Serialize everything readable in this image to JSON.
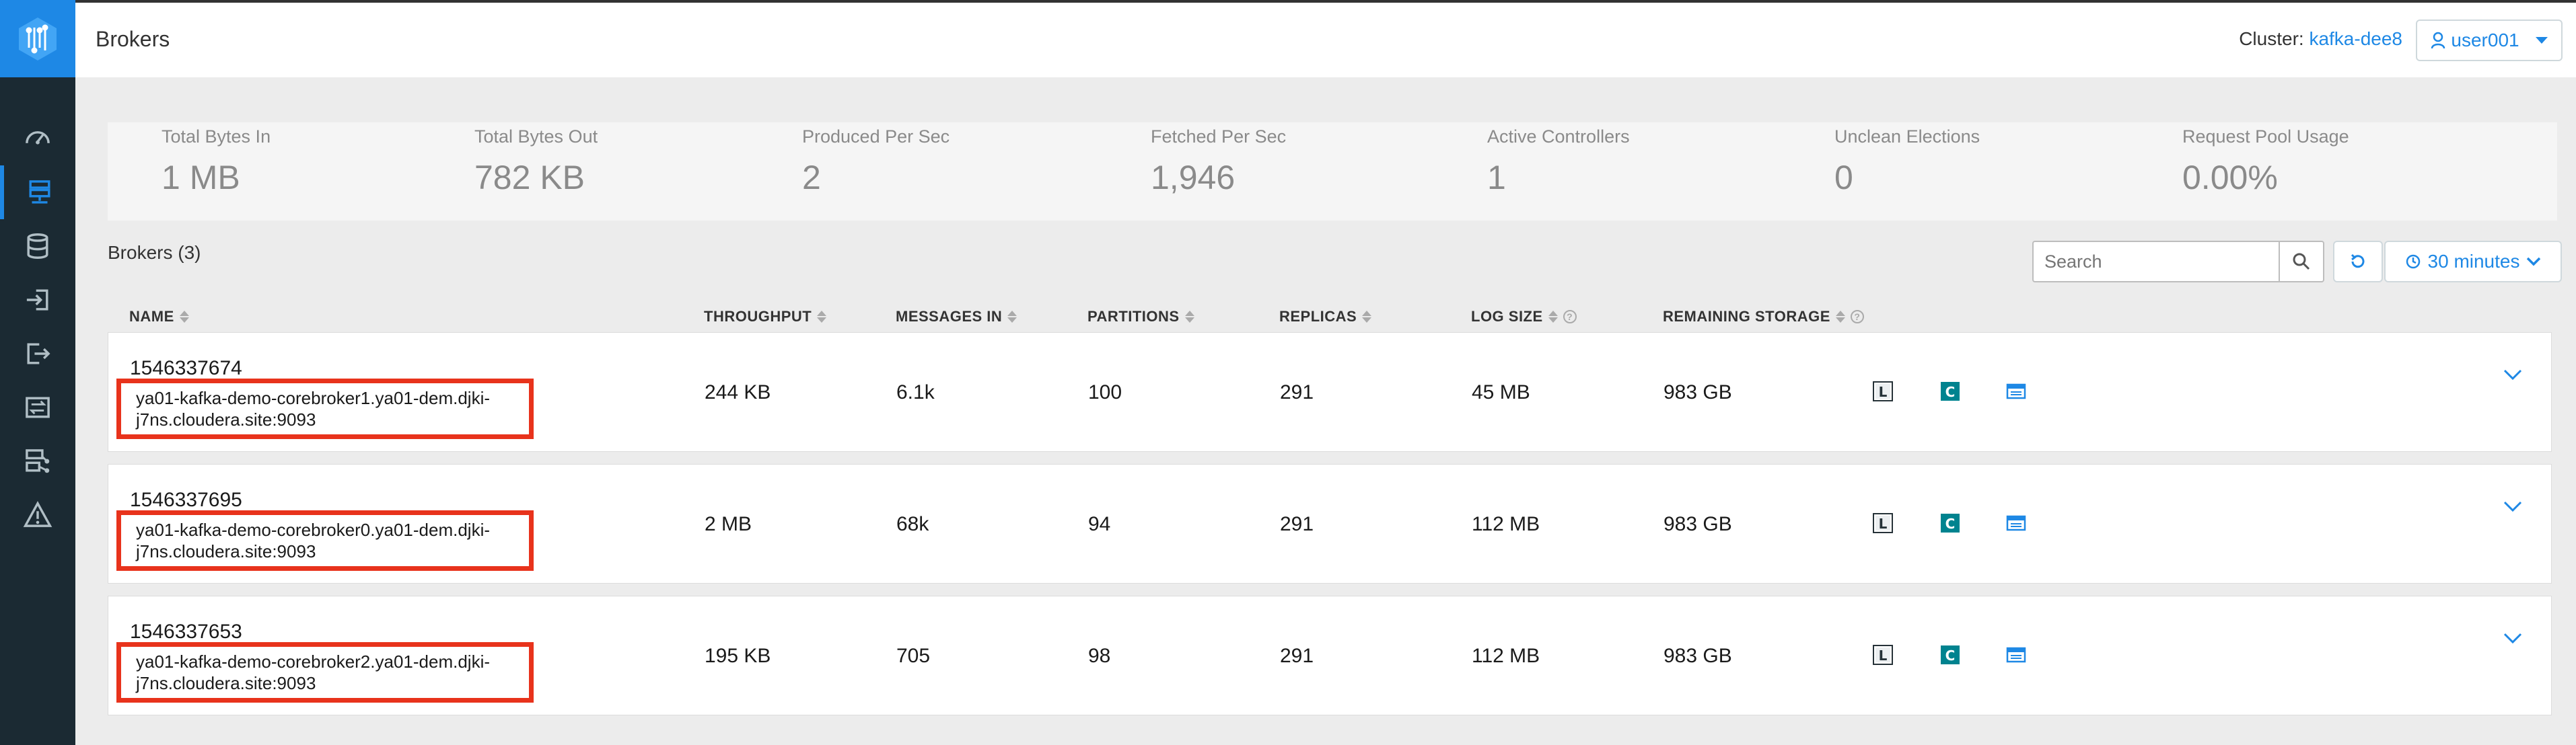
{
  "header": {
    "title": "Brokers",
    "cluster_label": "Cluster:",
    "cluster_name": "kafka-dee8",
    "user": "user001"
  },
  "nav": [
    {
      "icon": "gauge-icon"
    },
    {
      "icon": "brokers-icon",
      "active": true
    },
    {
      "icon": "database-icon"
    },
    {
      "icon": "producer-icon"
    },
    {
      "icon": "consumer-icon"
    },
    {
      "icon": "replication-icon"
    },
    {
      "icon": "topology-icon"
    },
    {
      "icon": "alert-icon"
    }
  ],
  "stats": [
    {
      "label": "Total Bytes In",
      "value": "1 MB"
    },
    {
      "label": "Total Bytes Out",
      "value": "782 KB"
    },
    {
      "label": "Produced Per Sec",
      "value": "2"
    },
    {
      "label": "Fetched Per Sec",
      "value": "1,946"
    },
    {
      "label": "Active Controllers",
      "value": "1"
    },
    {
      "label": "Unclean Elections",
      "value": "0"
    },
    {
      "label": "Request Pool Usage",
      "value": "0.00%"
    }
  ],
  "brokers_title": "Brokers (3)",
  "search": {
    "placeholder": "Search",
    "value": ""
  },
  "time_range": "30 minutes",
  "columns": [
    "NAME",
    "THROUGHPUT",
    "MESSAGES IN",
    "PARTITIONS",
    "REPLICAS",
    "LOG SIZE",
    "REMAINING STORAGE"
  ],
  "rows": [
    {
      "id": "1546337674",
      "host_line1": "ya01-kafka-demo-corebroker1.ya01-dem.djki-",
      "host_line2": "j7ns.cloudera.site:9093",
      "throughput": "244 KB",
      "messages_in": "6.1k",
      "partitions": "100",
      "replicas": "291",
      "log_size": "45 MB",
      "remaining_storage": "983 GB"
    },
    {
      "id": "1546337695",
      "host_line1": "ya01-kafka-demo-corebroker0.ya01-dem.djki-",
      "host_line2": "j7ns.cloudera.site:9093",
      "throughput": "2 MB",
      "messages_in": "68k",
      "partitions": "94",
      "replicas": "291",
      "log_size": "112 MB",
      "remaining_storage": "983 GB"
    },
    {
      "id": "1546337653",
      "host_line1": "ya01-kafka-demo-corebroker2.ya01-dem.djki-",
      "host_line2": "j7ns.cloudera.site:9093",
      "throughput": "195 KB",
      "messages_in": "705",
      "partitions": "98",
      "replicas": "291",
      "log_size": "112 MB",
      "remaining_storage": "983 GB"
    }
  ],
  "icons": {
    "log_icon": "L",
    "config_icon": "C"
  },
  "colors": {
    "accent": "#1e88e5",
    "sidebar": "#1b2a33",
    "highlight": "#e8331c"
  }
}
